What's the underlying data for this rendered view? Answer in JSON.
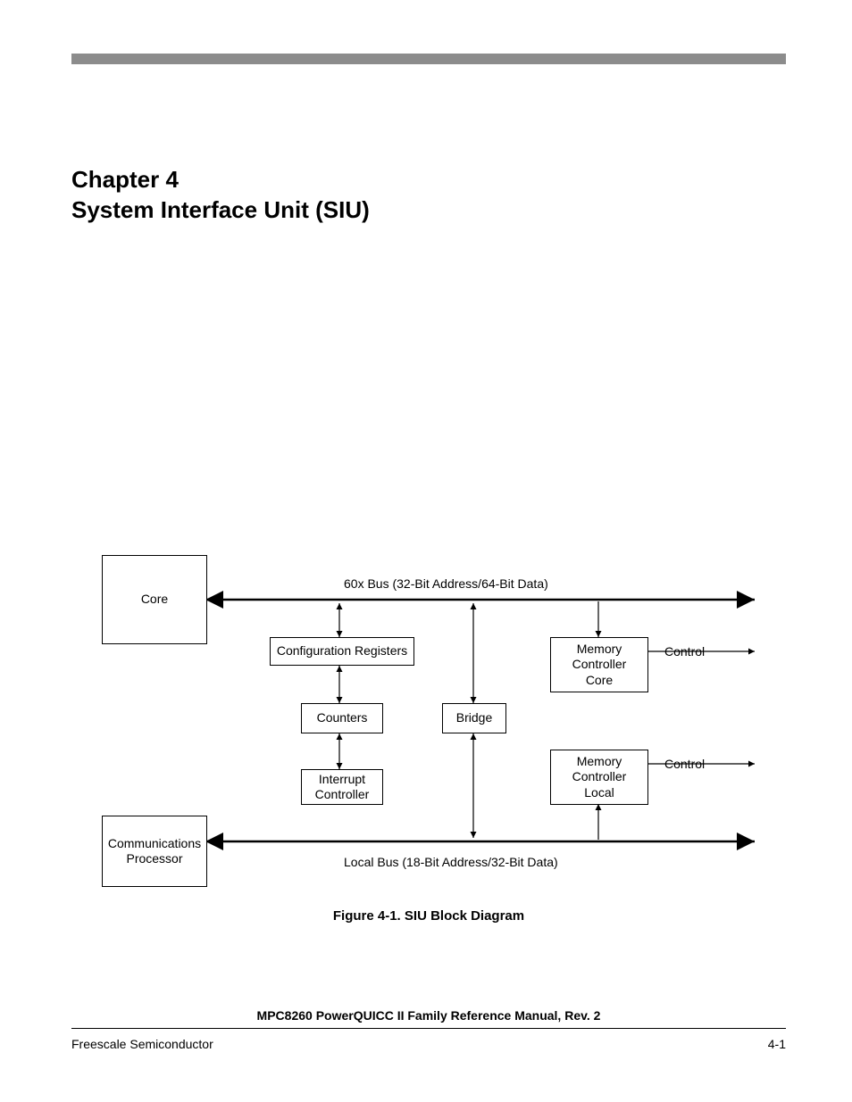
{
  "chapter": {
    "number_line": "Chapter 4",
    "title_line": "System Interface Unit (SIU)"
  },
  "diagram": {
    "bus_top": "60x Bus (32-Bit Address/64-Bit Data)",
    "bus_bottom": "Local Bus (18-Bit Address/32-Bit Data)",
    "blocks": {
      "core": "Core",
      "config": "Configuration Registers",
      "counters": "Counters",
      "interrupt_l1": "Interrupt",
      "interrupt_l2": "Controller",
      "bridge": "Bridge",
      "mem_core_l1": "Memory",
      "mem_core_l2": "Controller",
      "mem_core_l3": "Core",
      "mem_local_l1": "Memory",
      "mem_local_l2": "Controller",
      "mem_local_l3": "Local",
      "comm_l1": "Communications",
      "comm_l2": "Processor"
    },
    "labels": {
      "control1": "Control",
      "control2": "Control"
    },
    "caption": "Figure 4-1. SIU Block Diagram"
  },
  "footer": {
    "manual": "MPC8260 PowerQUICC II Family Reference Manual, Rev. 2",
    "left": "Freescale Semiconductor",
    "right": "4-1"
  }
}
